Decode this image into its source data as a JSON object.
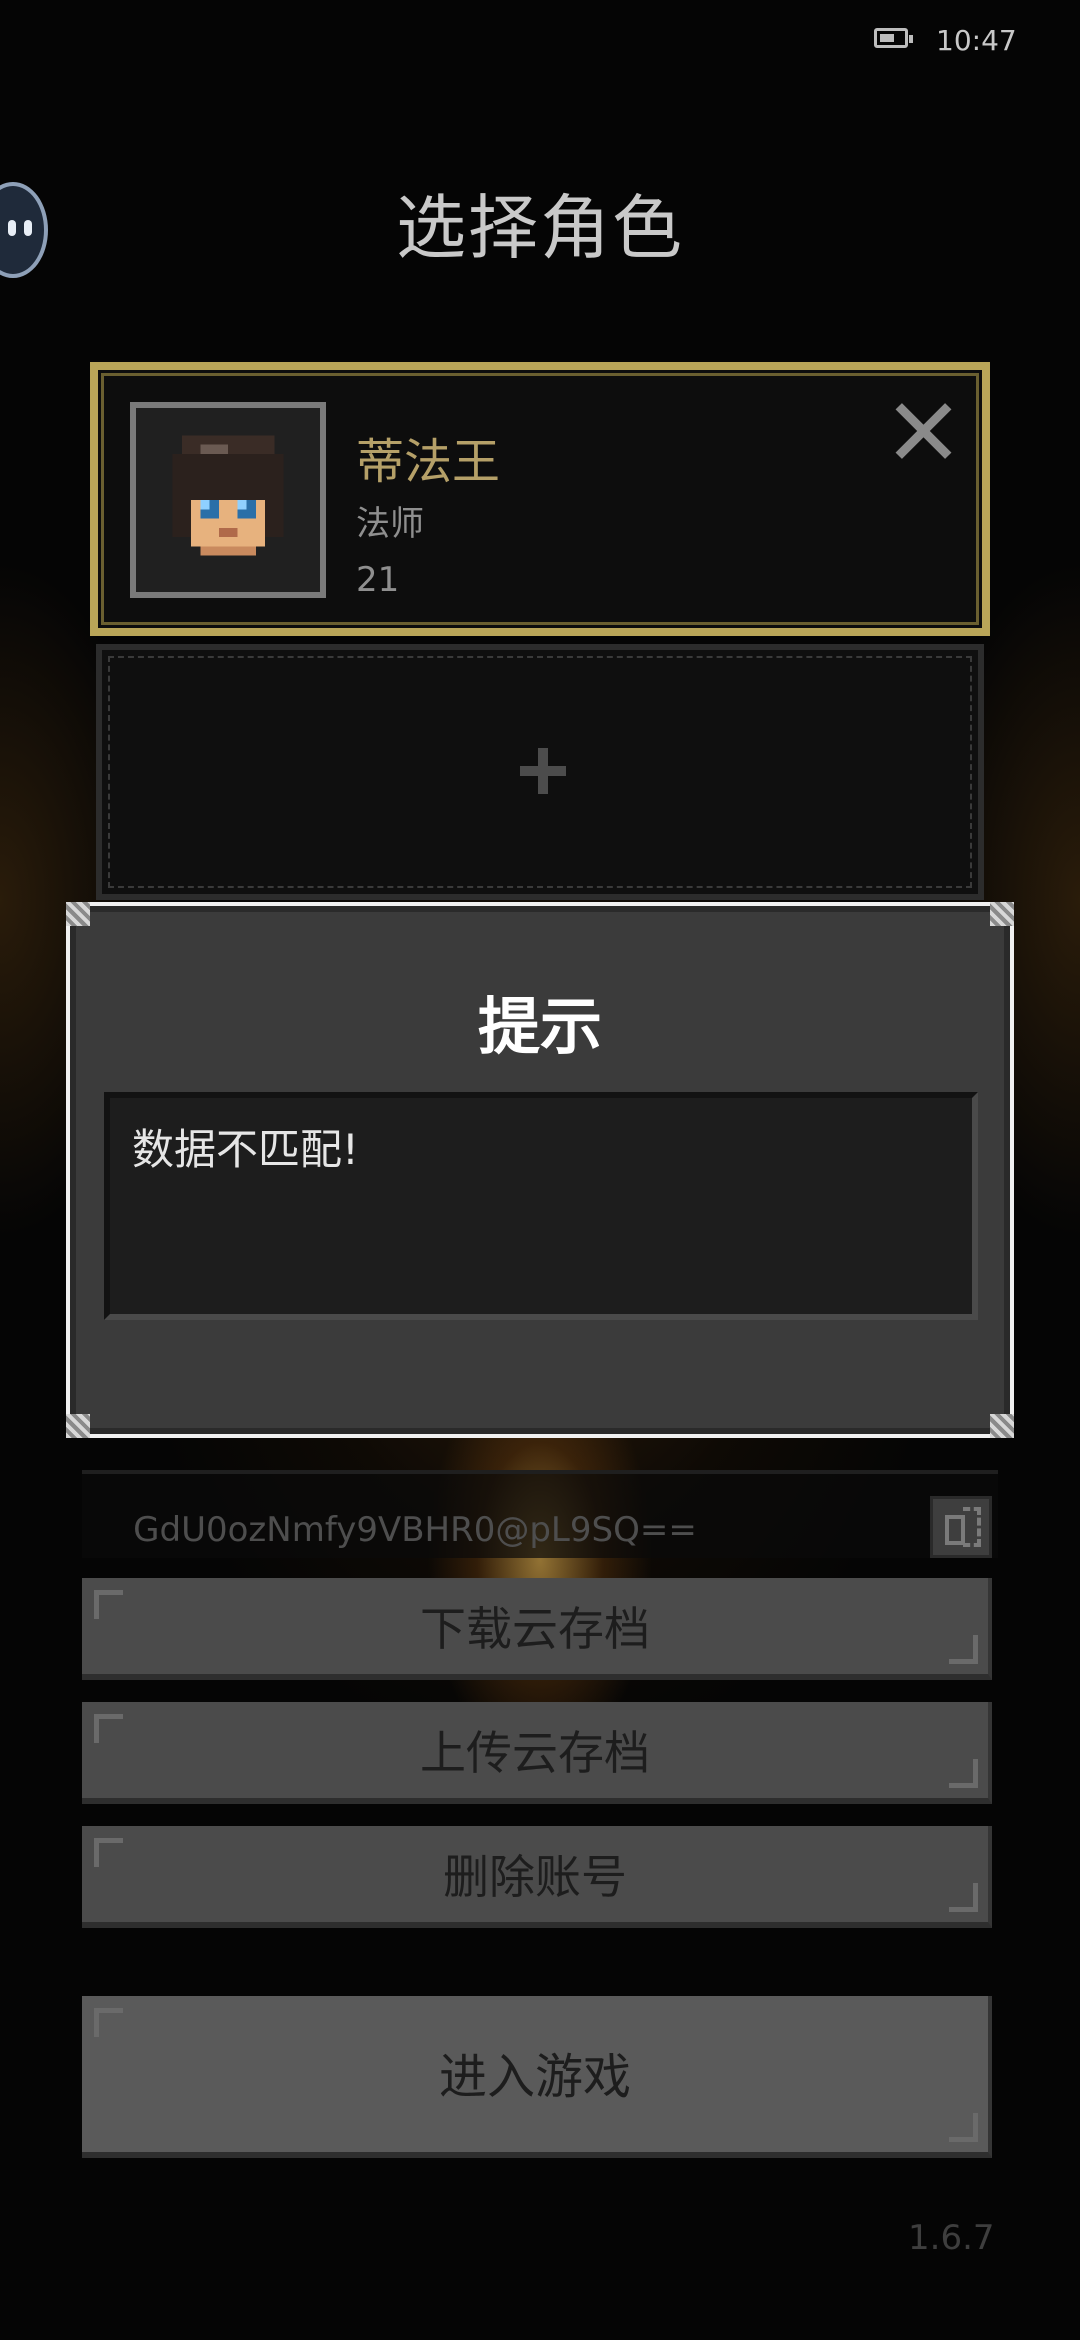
{
  "status_bar": {
    "time": "10:47",
    "battery_icon": "battery-icon"
  },
  "header": {
    "title": "选择角色"
  },
  "characters": [
    {
      "name": "蒂法王",
      "class": "法师",
      "level": "21",
      "selected": true
    }
  ],
  "empty_slot": {
    "icon": "plus-icon"
  },
  "dialog": {
    "title": "提示",
    "message": "数据不匹配!"
  },
  "account": {
    "id": "GdU0ozNmfy9VBHR0@pL9SQ==",
    "copy_icon": "copy-icon"
  },
  "buttons": {
    "download": "下载云存档",
    "upload": "上传云存档",
    "delete": "删除账号",
    "enter": "进入游戏"
  },
  "version": "1.6.7",
  "colors": {
    "selected_border": "#b9a558",
    "name_gold": "#b5a068",
    "dialog_bg": "#3b3b3b"
  }
}
